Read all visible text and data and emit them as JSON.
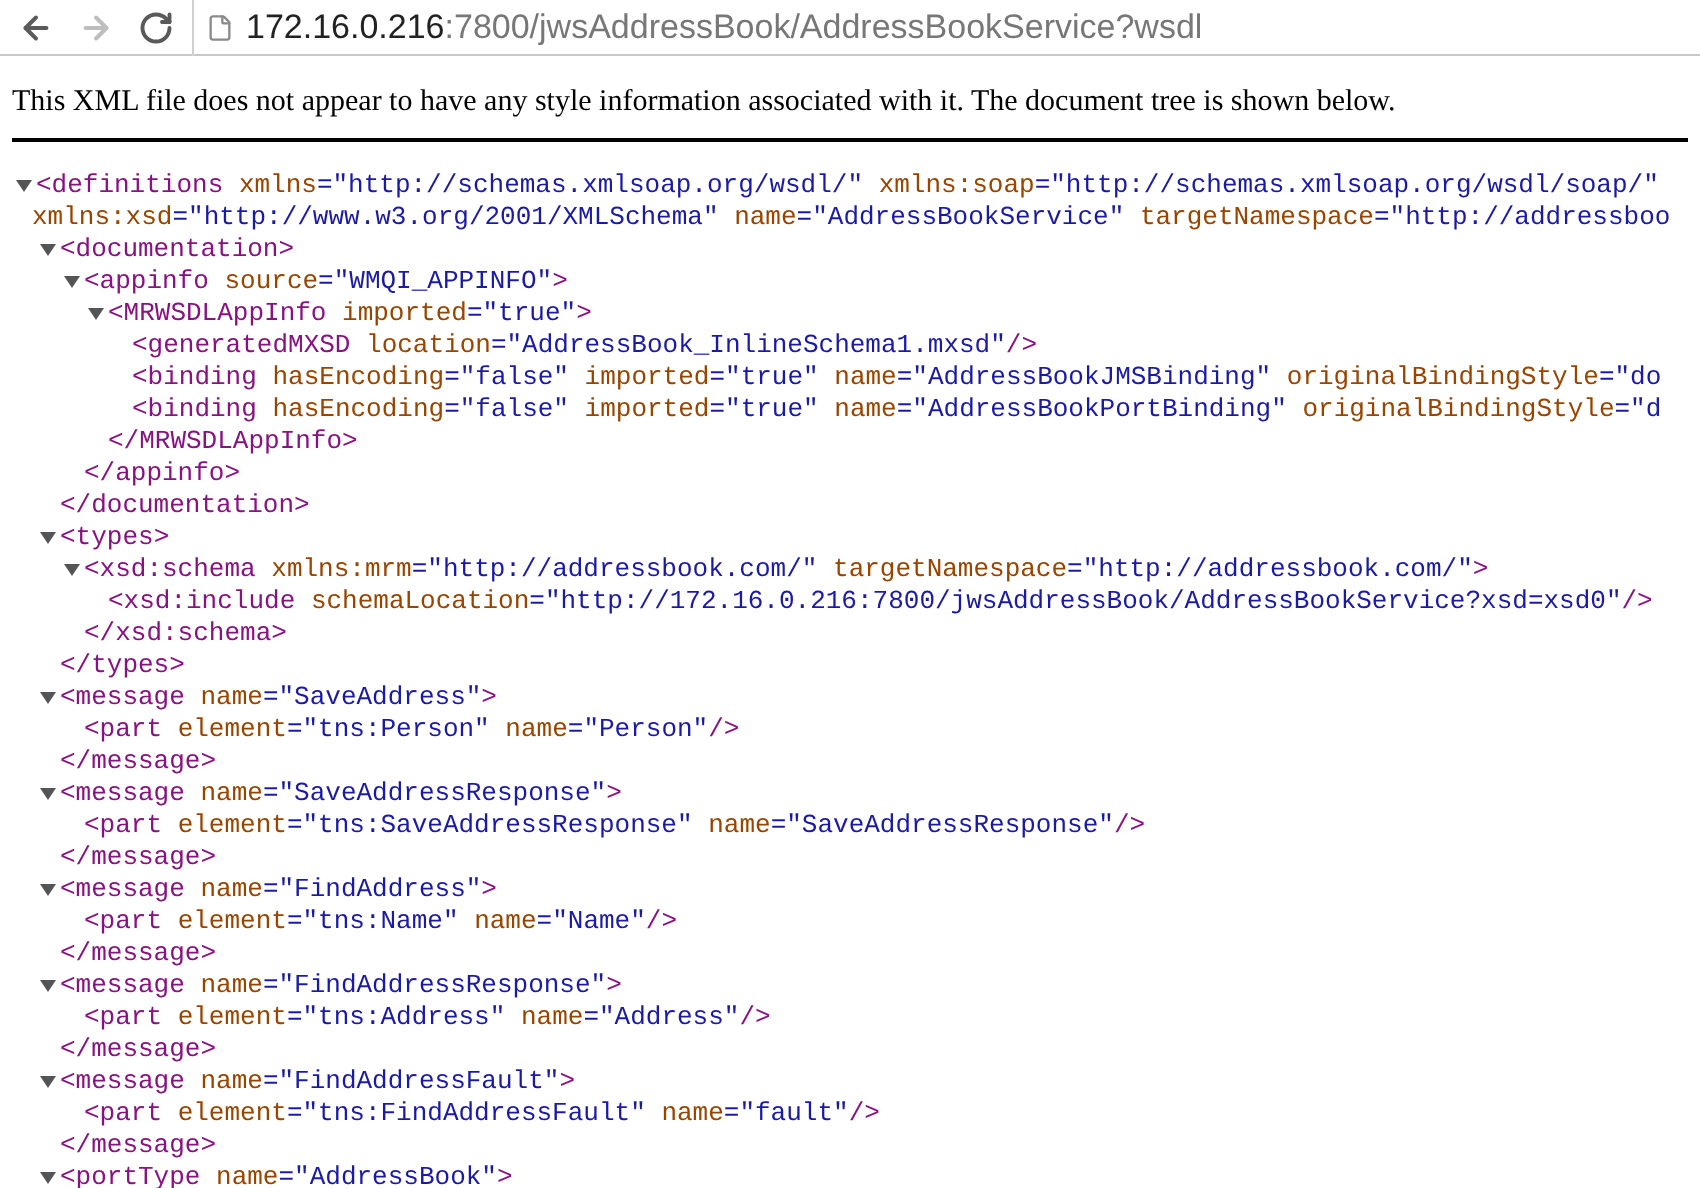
{
  "browser": {
    "nav_buttons": [
      {
        "kind": "back",
        "disabled": false
      },
      {
        "kind": "forward",
        "disabled": true
      },
      {
        "kind": "reload",
        "disabled": false
      }
    ],
    "url": {
      "host": "172.16.0.216",
      "rest": ":7800/jwsAddressBook/AddressBookService?wsdl"
    }
  },
  "notice": "This XML file does not appear to have any style information associated with it. The document tree is shown below.",
  "xml_tree": [
    {
      "tag_open": "<definitions",
      "expanded": true,
      "attribute_lines": [
        [
          {
            "name": "xmlns",
            "value": "=\"http://schemas.xmlsoap.org/wsdl/\""
          },
          {
            "name": "xmlns:soap",
            "value": "=\"http://schemas.xmlsoap.org/wsdl/soap/\""
          }
        ],
        [
          {
            "name": "xmlns:xsd",
            "value": "=\"http://www.w3.org/2001/XMLSchema\""
          },
          {
            "name": "name",
            "value": "=\"AddressBookService\""
          },
          {
            "name": "targetNamespace",
            "value": "=\"http://addressboo"
          }
        ]
      ],
      "children": [
        {
          "tag_open": "<documentation",
          "tag_end": ">",
          "close": "</documentation>",
          "expanded": true,
          "children": [
            {
              "tag_open": "<appinfo",
              "tag_end": ">",
              "close": "</appinfo>",
              "expanded": true,
              "attributes": [
                {
                  "name": "source",
                  "value": "=\"WMQI_APPINFO\""
                }
              ],
              "children": [
                {
                  "tag_open": "<MRWSDLAppInfo",
                  "tag_end": ">",
                  "close": "</MRWSDLAppInfo>",
                  "expanded": true,
                  "attributes": [
                    {
                      "name": "imported",
                      "value": "=\"true\""
                    }
                  ],
                  "children": [
                    {
                      "tag_open": "<generatedMXSD",
                      "tag_end": "/>",
                      "attributes": [
                        {
                          "name": "location",
                          "value": "=\"AddressBook_InlineSchema1.mxsd\""
                        }
                      ]
                    },
                    {
                      "tag_open": "<binding",
                      "attributes": [
                        {
                          "name": "hasEncoding",
                          "value": "=\"false\""
                        },
                        {
                          "name": "imported",
                          "value": "=\"true\""
                        },
                        {
                          "name": "name",
                          "value": "=\"AddressBookJMSBinding\""
                        },
                        {
                          "name": "originalBindingStyle",
                          "value": "=\"do"
                        }
                      ]
                    },
                    {
                      "tag_open": "<binding",
                      "attributes": [
                        {
                          "name": "hasEncoding",
                          "value": "=\"false\""
                        },
                        {
                          "name": "imported",
                          "value": "=\"true\""
                        },
                        {
                          "name": "name",
                          "value": "=\"AddressBookPortBinding\""
                        },
                        {
                          "name": "originalBindingStyle",
                          "value": "=\"d"
                        }
                      ]
                    }
                  ]
                }
              ]
            }
          ]
        },
        {
          "tag_open": "<types",
          "tag_end": ">",
          "close": "</types>",
          "expanded": true,
          "children": [
            {
              "tag_open": "<xsd:schema",
              "tag_end": ">",
              "close": "</xsd:schema>",
              "expanded": true,
              "attributes": [
                {
                  "name": "xmlns:mrm",
                  "value": "=\"http://addressbook.com/\""
                },
                {
                  "name": "targetNamespace",
                  "value": "=\"http://addressbook.com/\""
                }
              ],
              "children": [
                {
                  "tag_open": "<xsd:include",
                  "tag_end": "/>",
                  "attributes": [
                    {
                      "name": "schemaLocation",
                      "value": "=\"http://172.16.0.216:7800/jwsAddressBook/AddressBookService?xsd=xsd0\""
                    }
                  ]
                }
              ]
            }
          ]
        },
        {
          "tag_open": "<message",
          "tag_end": ">",
          "close": "</message>",
          "expanded": true,
          "attributes": [
            {
              "name": "name",
              "value": "=\"SaveAddress\""
            }
          ],
          "children": [
            {
              "tag_open": "<part",
              "tag_end": "/>",
              "attributes": [
                {
                  "name": "element",
                  "value": "=\"tns:Person\""
                },
                {
                  "name": "name",
                  "value": "=\"Person\""
                }
              ]
            }
          ]
        },
        {
          "tag_open": "<message",
          "tag_end": ">",
          "close": "</message>",
          "expanded": true,
          "attributes": [
            {
              "name": "name",
              "value": "=\"SaveAddressResponse\""
            }
          ],
          "children": [
            {
              "tag_open": "<part",
              "tag_end": "/>",
              "attributes": [
                {
                  "name": "element",
                  "value": "=\"tns:SaveAddressResponse\""
                },
                {
                  "name": "name",
                  "value": "=\"SaveAddressResponse\""
                }
              ]
            }
          ]
        },
        {
          "tag_open": "<message",
          "tag_end": ">",
          "close": "</message>",
          "expanded": true,
          "attributes": [
            {
              "name": "name",
              "value": "=\"FindAddress\""
            }
          ],
          "children": [
            {
              "tag_open": "<part",
              "tag_end": "/>",
              "attributes": [
                {
                  "name": "element",
                  "value": "=\"tns:Name\""
                },
                {
                  "name": "name",
                  "value": "=\"Name\""
                }
              ]
            }
          ]
        },
        {
          "tag_open": "<message",
          "tag_end": ">",
          "close": "</message>",
          "expanded": true,
          "attributes": [
            {
              "name": "name",
              "value": "=\"FindAddressResponse\""
            }
          ],
          "children": [
            {
              "tag_open": "<part",
              "tag_end": "/>",
              "attributes": [
                {
                  "name": "element",
                  "value": "=\"tns:Address\""
                },
                {
                  "name": "name",
                  "value": "=\"Address\""
                }
              ]
            }
          ]
        },
        {
          "tag_open": "<message",
          "tag_end": ">",
          "close": "</message>",
          "expanded": true,
          "attributes": [
            {
              "name": "name",
              "value": "=\"FindAddressFault\""
            }
          ],
          "children": [
            {
              "tag_open": "<part",
              "tag_end": "/>",
              "attributes": [
                {
                  "name": "element",
                  "value": "=\"tns:FindAddressFault\""
                },
                {
                  "name": "name",
                  "value": "=\"fault\""
                }
              ]
            }
          ]
        },
        {
          "tag_open": "<portType",
          "tag_end": ">",
          "expanded": true,
          "attributes": [
            {
              "name": "name",
              "value": "=\"AddressBook\""
            }
          ]
        }
      ]
    }
  ]
}
